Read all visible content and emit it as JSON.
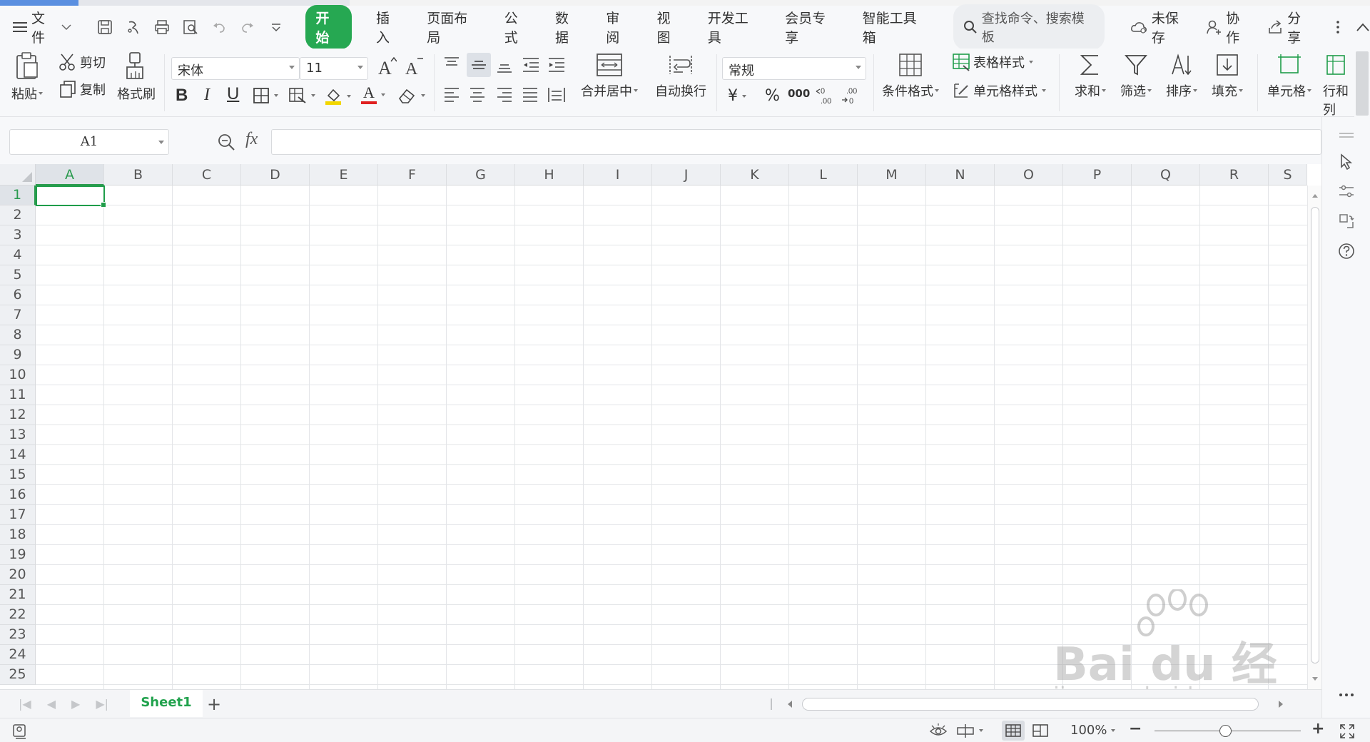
{
  "menu": {
    "file_label": "文件",
    "tabs": [
      "开始",
      "插入",
      "页面布局",
      "公式",
      "数据",
      "审阅",
      "视图",
      "开发工具",
      "会员专享",
      "智能工具箱"
    ],
    "active_tab": "开始",
    "search_placeholder": "查找命令、搜索模板",
    "unsaved_label": "未保存",
    "collaborate_label": "协作",
    "share_label": "分享"
  },
  "ribbon": {
    "paste": "粘贴",
    "cut": "剪切",
    "copy": "复制",
    "format_painter": "格式刷",
    "font_name": "宋体",
    "font_size": "11",
    "bold": "B",
    "italic": "I",
    "underline": "U",
    "font_color_glyph": "A",
    "merge_center": "合并居中",
    "wrap_text": "自动换行",
    "number_format": "常规",
    "currency": "¥",
    "percent": "%",
    "thousands": "000",
    "conditional_format": "条件格式",
    "table_style": "表格样式",
    "cell_style": "单元格样式",
    "sum": "求和",
    "filter": "筛选",
    "sort": "排序",
    "fill": "填充",
    "cell": "单元格",
    "rows_cols": "行和列"
  },
  "formula_bar": {
    "name_box": "A1",
    "fx_label": "fx",
    "formula": ""
  },
  "grid": {
    "columns": [
      "A",
      "B",
      "C",
      "D",
      "E",
      "F",
      "G",
      "H",
      "I",
      "J",
      "K",
      "L",
      "M",
      "N",
      "O",
      "P",
      "Q",
      "R",
      "S"
    ],
    "rows": [
      "1",
      "2",
      "3",
      "4",
      "5",
      "6",
      "7",
      "8",
      "9",
      "10",
      "11",
      "12",
      "13",
      "14",
      "15",
      "16",
      "17",
      "18",
      "19",
      "20",
      "21",
      "22",
      "23",
      "24",
      "25"
    ],
    "selected_col": "A",
    "selected_row": "1"
  },
  "sheets": {
    "tabs": [
      "Sheet1"
    ],
    "active": "Sheet1",
    "add_label": "+"
  },
  "status": {
    "zoom": "100%",
    "zoom_minus": "−",
    "zoom_plus": "+"
  },
  "watermark": {
    "brand": "Bai du 经验",
    "url": "jingyan.baidu.com"
  },
  "colors": {
    "accent_green": "#21a24d",
    "active_tab_bg": "#26a852",
    "selection": "#1f9d4a"
  }
}
